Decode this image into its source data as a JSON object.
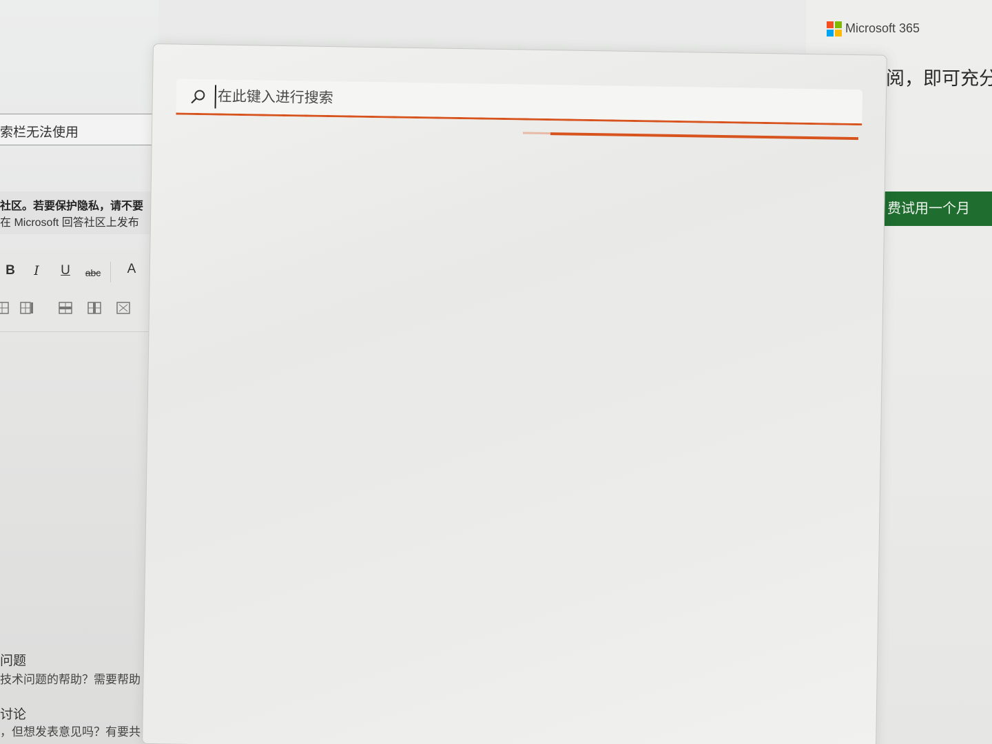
{
  "background_page": {
    "title_field_value": "索栏无法使用",
    "notice_line_1": "社区。若要保护隐私，请不要",
    "notice_line_2": "在 Microsoft 回答社区上发布",
    "toolbar": {
      "bold": "B",
      "italic": "I",
      "underline": "U",
      "strikethrough": "abc",
      "font": "A"
    },
    "section_1_heading": "问题",
    "section_1_text": "技术问题的帮助？需要帮助",
    "section_2_heading": "讨论",
    "section_2_text": "，但想发表意见吗？有要共",
    "brand": "Microsoft 365",
    "promo_text": "阅，即可充分",
    "trial_button": "费试用一个月",
    "colors": {
      "trial_green": "#1f6d2f",
      "ms_red": "#f25022",
      "ms_green": "#7fba00",
      "ms_blue": "#00a4ef",
      "ms_yellow": "#ffb900"
    }
  },
  "search_flyout": {
    "search_placeholder": "在此键入进行搜索",
    "search_value": "",
    "search_icon": "search-icon",
    "loading_progress": 0.92,
    "accent_color": "#d8541f"
  }
}
